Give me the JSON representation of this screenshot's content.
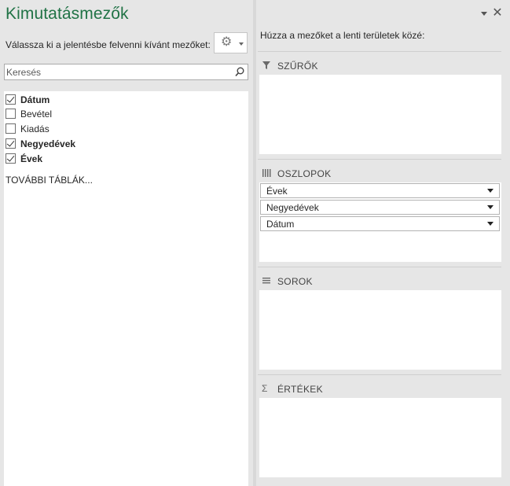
{
  "panel": {
    "title": "Kimutatásmezők",
    "prompt": "Válassza ki a jelentésbe felvenni kívánt mezőket:",
    "search_placeholder": "Keresés",
    "more_tables": "TOVÁBBI TÁBLÁK...",
    "drag_hint": "Húzza a mezőket a lenti területek közé:"
  },
  "fields": [
    {
      "label": "Dátum",
      "checked": true
    },
    {
      "label": "Bevétel",
      "checked": false
    },
    {
      "label": "Kiadás",
      "checked": false
    },
    {
      "label": "Negyedévek",
      "checked": true
    },
    {
      "label": "Évek",
      "checked": true
    }
  ],
  "areas": {
    "filters": {
      "label": "SZŰRŐK",
      "icon": "filter-icon"
    },
    "columns": {
      "label": "OSZLOPOK",
      "icon": "columns-icon",
      "items": [
        "Évek",
        "Negyedévek",
        "Dátum"
      ]
    },
    "rows": {
      "label": "SOROK",
      "icon": "rows-icon"
    },
    "values": {
      "label": "ÉRTÉKEK",
      "icon": "sigma-icon"
    }
  },
  "colors": {
    "title": "#217346",
    "background": "#e6e6e6"
  }
}
